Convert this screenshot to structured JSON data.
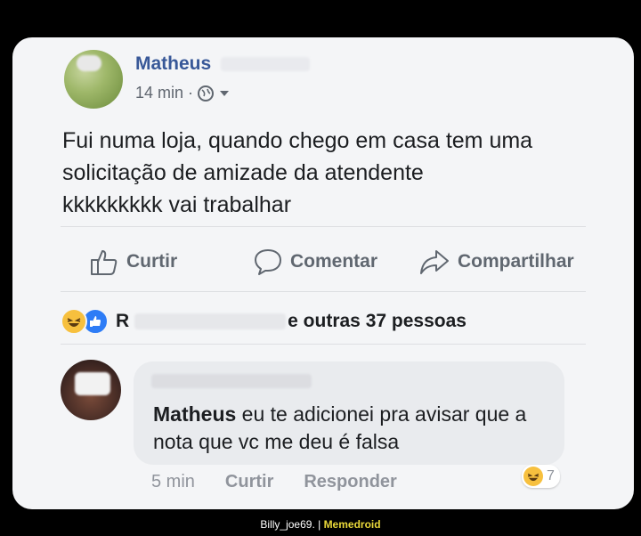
{
  "post": {
    "author": "Matheus",
    "time": "14 min · ",
    "text": "Fui numa loja, quando chego em casa tem uma\nsolicitação de amizade da atendente\nkkkkkkkkk vai trabalhar"
  },
  "actions": {
    "like": "Curtir",
    "comment": "Comentar",
    "share": "Compartilhar"
  },
  "reactions": {
    "prefix": "R",
    "suffix": "e outras 37 pessoas"
  },
  "comment": {
    "mention": "Matheus",
    "text": " eu te adicionei pra avisar que a nota que vc me deu é falsa",
    "time": "5 min",
    "like": "Curtir",
    "reply": "Responder",
    "reaction_count": "7"
  },
  "footer": {
    "user": "Billy_joe69. | ",
    "brand": "Memedroid"
  },
  "colors": {
    "name": "#385898",
    "like_blue": "#2d7cf6",
    "haha": "#f7c03e"
  }
}
